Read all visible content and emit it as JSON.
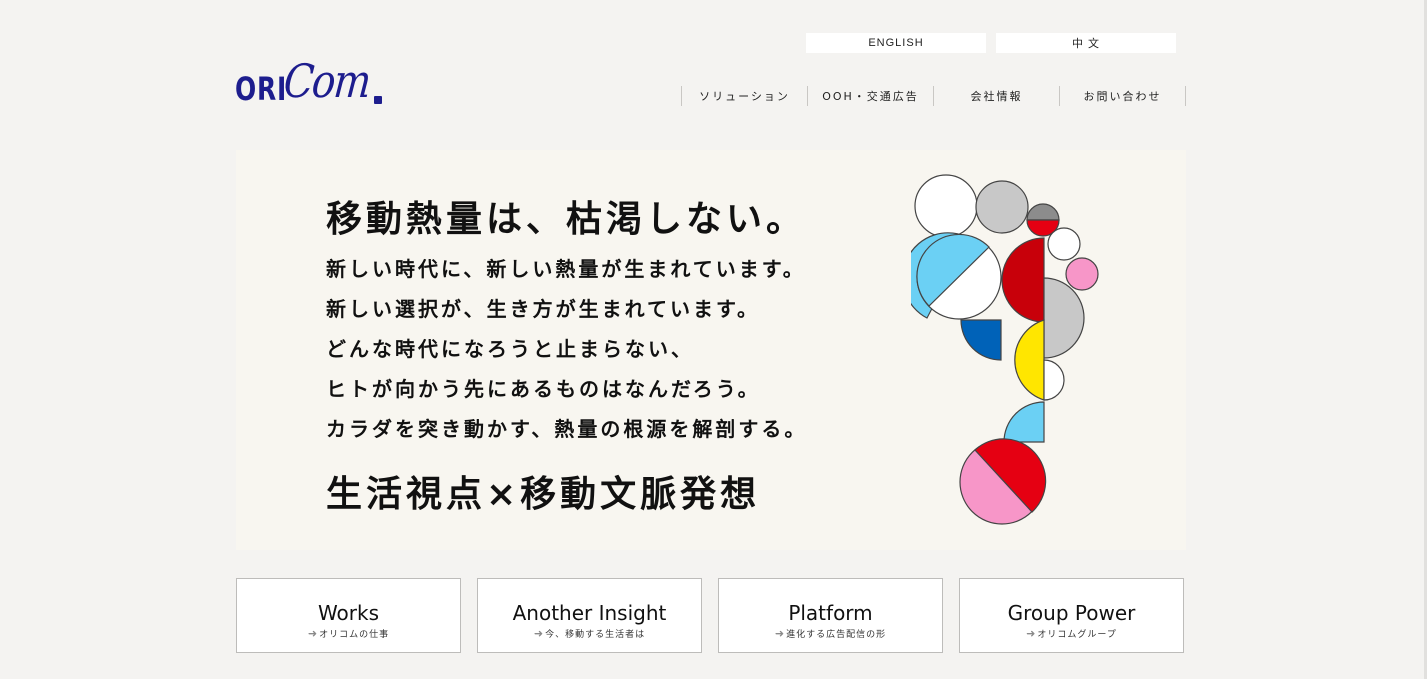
{
  "header": {
    "lang_buttons": [
      "ENGLISH",
      "中 文"
    ],
    "logo": {
      "text_left": "ORI",
      "text_script": "Com",
      "color": "#1d1d8e"
    },
    "nav": [
      "ソリューション",
      "OOH・交通広告",
      "会社情報",
      "お問い合わせ"
    ]
  },
  "hero": {
    "headline": "移動熱量は、枯渇しない。",
    "lines": [
      "新しい時代に、新しい熱量が生まれています。",
      "新しい選択が、生き方が生まれています。",
      "どんな時代になろうと止まらない、",
      "ヒトが向かう先にあるものはなんだろう。",
      "カラダを突き動かす、熱量の根源を解剖する。"
    ],
    "tagline": "生活視点×移動文脈発想",
    "art_colors": {
      "red": "#e50012",
      "dark_red": "#c8000a",
      "blue": "#0062b8",
      "light_blue": "#6bd0f4",
      "yellow": "#ffe600",
      "pink": "#f796c8",
      "gray": "#c8c8c8",
      "dark_gray": "#8c8c8c"
    }
  },
  "cards": [
    {
      "title": "Works",
      "subtitle": "オリコムの仕事"
    },
    {
      "title": "Another Insight",
      "subtitle": "今、移動する生活者は"
    },
    {
      "title": "Platform",
      "subtitle": "進化する広告配信の形"
    },
    {
      "title": "Group Power",
      "subtitle": "オリコムグループ"
    }
  ],
  "icons": {
    "card_arrow": "arrow-right-icon"
  }
}
